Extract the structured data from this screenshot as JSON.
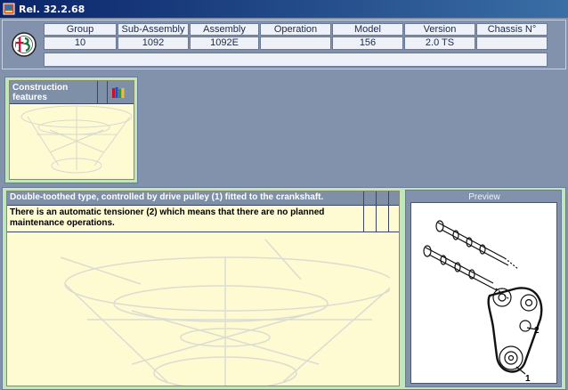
{
  "window": {
    "title": "Rel. 32.2.68",
    "icon": "app-icon"
  },
  "header": {
    "logo": "alfa-romeo-logo",
    "columns": [
      {
        "label": "Group",
        "value": "10"
      },
      {
        "label": "Sub-Assembly",
        "value": "1092"
      },
      {
        "label": "Assembly",
        "value": "1092E"
      },
      {
        "label": "Operation",
        "value": ""
      },
      {
        "label": "Model",
        "value": "156"
      },
      {
        "label": "Version",
        "value": "2.0 TS"
      },
      {
        "label": "Chassis N°",
        "value": ""
      }
    ]
  },
  "thumbnail": {
    "heading": "Construction features",
    "icon": "books-icon"
  },
  "main": {
    "description_title": "Double-toothed type, controlled by drive pulley (1) fitted to the crankshaft.",
    "description_body": "There is an automatic tensioner (2) which means that there are no planned maintenance operations."
  },
  "preview": {
    "label": "Preview",
    "callouts": [
      "1",
      "2"
    ]
  },
  "colors": {
    "background": "#8292ad",
    "panel_green": "#bfe6bc",
    "panel_yellow": "#fefbd2",
    "heading_blue": "#7e8fa8",
    "title_bar": "#0a246a"
  }
}
